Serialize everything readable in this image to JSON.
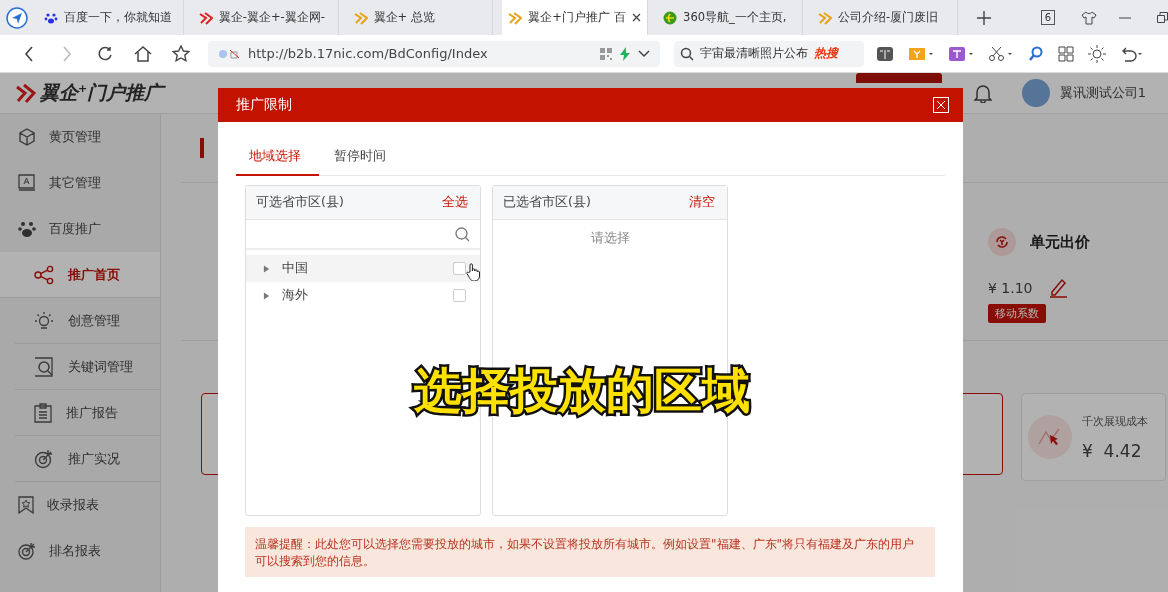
{
  "browser": {
    "tabs": [
      {
        "label": "百度一下，你就知道",
        "selected": false
      },
      {
        "label": "翼企-翼企+-翼企网-",
        "selected": false
      },
      {
        "label": "翼企+ 总览",
        "selected": false
      },
      {
        "label": "翼企+门户推广 百",
        "selected": true
      },
      {
        "label": "360导航_一个主页,",
        "selected": false
      },
      {
        "label": "公司介绍-厦门废旧",
        "selected": false
      }
    ],
    "tab_count": "6",
    "url": "http://b2b.17nic.com/BdConfig/Index",
    "search_text": "宇宙最清晰照片公布",
    "hot_badge": "热搜"
  },
  "app": {
    "logo": "翼企$^{+}$门户推广",
    "user_name": "翼讯测试公司1",
    "sidebar": {
      "items": [
        {
          "label": "黄页管理",
          "selected": false
        },
        {
          "label": "其它管理",
          "selected": false
        },
        {
          "label": "百度推广",
          "selected": false,
          "children": [
            {
              "label": "推广首页",
              "selected": true
            },
            {
              "label": "创意管理",
              "selected": false
            },
            {
              "label": "关键词管理",
              "selected": false
            },
            {
              "label": "推广报告",
              "selected": false
            },
            {
              "label": "推广实况",
              "selected": false
            }
          ]
        },
        {
          "label": "收录报表",
          "selected": false
        },
        {
          "label": "排名报表",
          "selected": false
        }
      ]
    },
    "bid_card": {
      "title": "单元出价",
      "value": "¥ 1.10",
      "tag": "移动系数"
    },
    "cost_card": {
      "title": "千次展现成本",
      "value": "¥  4.42"
    }
  },
  "modal": {
    "title": "推广限制",
    "tabs": [
      {
        "label": "地域选择",
        "selected": true
      },
      {
        "label": "暂停时间",
        "selected": false
      }
    ],
    "available": {
      "title": "可选省市区(县)",
      "action": "全选",
      "nodes": [
        {
          "label": "中国",
          "expanded": false,
          "checked": false,
          "hovered": true
        },
        {
          "label": "海外",
          "expanded": false,
          "checked": false,
          "hovered": false
        }
      ]
    },
    "chosen": {
      "title": "已选省市区(县)",
      "action": "清空",
      "empty_text": "请选择"
    },
    "notice": "温馨提醒：此处您可以选择您需要投放的城市，如果不设置将投放所有城市。例如设置\"福建、广东\"将只有福建及广东的用户可以搜索到您的信息。"
  },
  "caption": "选择投放的区域"
}
